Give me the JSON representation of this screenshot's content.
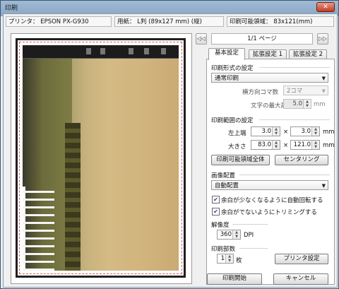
{
  "window": {
    "title": "印刷",
    "close_symbol": "✕"
  },
  "info": {
    "printer": "プリンタ：  EPSON PX-G930",
    "paper": "用紙：  L判 (89x127 mm) (縦)",
    "printable_area": "印刷可能領域：  83x121(mm)"
  },
  "page_nav": {
    "indicator": "1/1 ページ",
    "prev": "◁◁",
    "next": "▷▷"
  },
  "tabs": [
    {
      "label": "基本設定",
      "active": true
    },
    {
      "label": "拡張設定 1",
      "active": false
    },
    {
      "label": "拡張設定 2",
      "active": false
    }
  ],
  "print_format": {
    "heading": "印刷形式の設定",
    "format_value": "通常印刷",
    "frames_label": "横方向コマ数",
    "frames_value": "2コマ",
    "text_height_label": "文字の最大高さ",
    "text_height_value": "5.0",
    "text_height_unit": "mm"
  },
  "print_range": {
    "heading": "印刷範囲の設定",
    "topleft_label": "左上端",
    "left_value": "3.0",
    "top_value": "3.0",
    "size_label": "大きさ",
    "width_value": "83.0",
    "height_value": "121.0",
    "times": "×",
    "unit": "mm",
    "full_area_button": "印刷可能領域全体",
    "centering_button": "センタリング"
  },
  "image_layout": {
    "heading": "画像配置",
    "layout_value": "自動配置",
    "auto_rotate_label": "余白が少なくなるように自動回転する",
    "auto_rotate_checked": true,
    "trim_label": "余白がでないようにトリミングする",
    "trim_checked": true
  },
  "resolution": {
    "heading": "解像度",
    "value": "360",
    "unit": "DPI"
  },
  "copies": {
    "heading": "印刷部数",
    "value": "1",
    "unit": "枚",
    "printer_settings_button": "プリンタ設定"
  },
  "footer": {
    "start_button": "印刷開始",
    "cancel_button": "キャンセル"
  },
  "icons": {
    "dropdown": "▼",
    "spin_up": "▲",
    "spin_down": "▼",
    "check": "✔"
  },
  "colors": {
    "margin_guide": "#d85a5a",
    "title_bar": "#9fbad4",
    "close_button": "#c23b22"
  }
}
